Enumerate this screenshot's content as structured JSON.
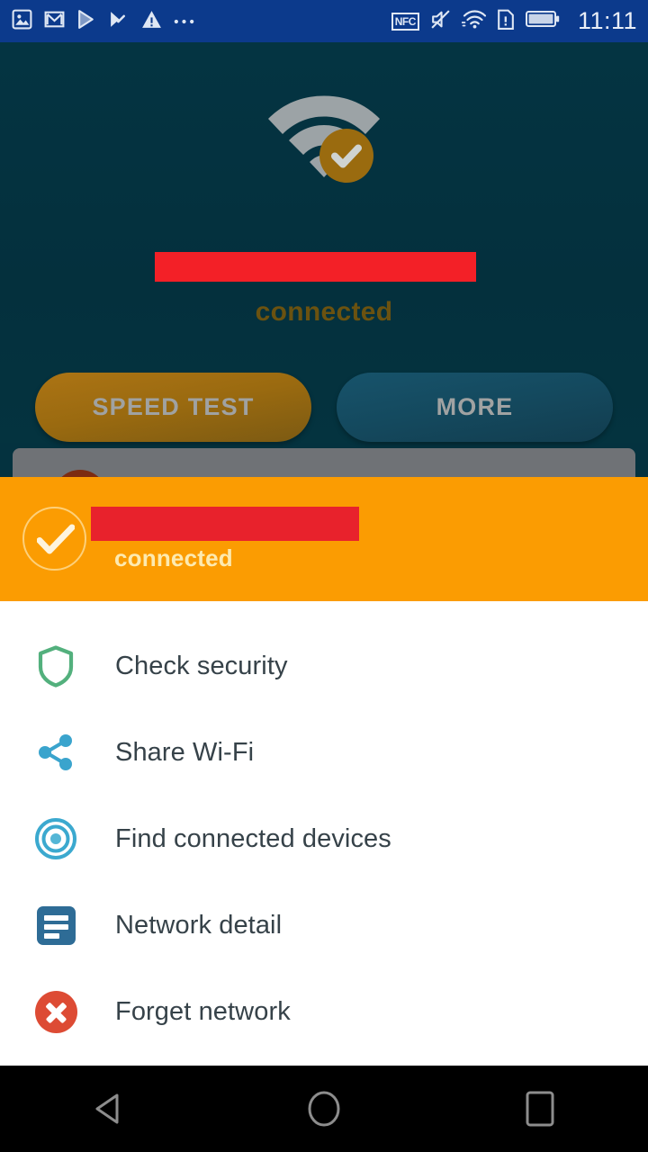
{
  "status_bar": {
    "time": "11:11",
    "nfc_label": "NFC",
    "left_icons": [
      {
        "name": "photos-icon"
      },
      {
        "name": "gmail-icon"
      },
      {
        "name": "play-store-icon"
      },
      {
        "name": "tasks-check-icon"
      },
      {
        "name": "warning-triangle-icon"
      },
      {
        "name": "more-dots-icon"
      }
    ],
    "right_icons": [
      {
        "name": "nfc-icon"
      },
      {
        "name": "volume-mute-icon"
      },
      {
        "name": "wifi-icon"
      },
      {
        "name": "sim-alert-icon"
      },
      {
        "name": "battery-icon"
      }
    ]
  },
  "hero": {
    "wifi_icon": "wifi-connected-check-icon",
    "ssid": "",
    "ssid_redacted": true,
    "status_text": "connected",
    "buttons": [
      {
        "name": "speed-test-button",
        "label": "SPEED TEST"
      },
      {
        "name": "more-button",
        "label": "MORE"
      }
    ]
  },
  "sheet": {
    "check_icon": "check-circle-icon",
    "ssid": "",
    "ssid_redacted": true,
    "status_text": "connected",
    "menu_items": [
      {
        "name": "check-security",
        "label": "Check security",
        "icon": "shield-icon"
      },
      {
        "name": "share-wifi",
        "label": "Share Wi-Fi",
        "icon": "share-icon"
      },
      {
        "name": "find-connected-devices",
        "label": "Find connected devices",
        "icon": "radar-target-icon"
      },
      {
        "name": "network-detail",
        "label": "Network detail",
        "icon": "document-lines-icon"
      },
      {
        "name": "forget-network",
        "label": "Forget network",
        "icon": "error-circle-x-icon"
      }
    ]
  },
  "nav_bar": {
    "back": "back-triangle-icon",
    "home": "home-circle-icon",
    "recents": "recents-square-icon"
  },
  "colors": {
    "status_bar_bg": "#0c3a8c",
    "app_bg": "#04323f",
    "accent_orange": "#fb9c02",
    "redaction_red": "#f32027",
    "speed_test_btn": "#9a6a10",
    "more_btn": "#14495e",
    "shield_green": "#53b07d",
    "share_blue": "#3aa4cd",
    "radar_cyan": "#3ba9cf",
    "network_detail_blue": "#2e6c96",
    "forget_red": "#dd4b34",
    "nav_bar_bg": "#000000"
  }
}
